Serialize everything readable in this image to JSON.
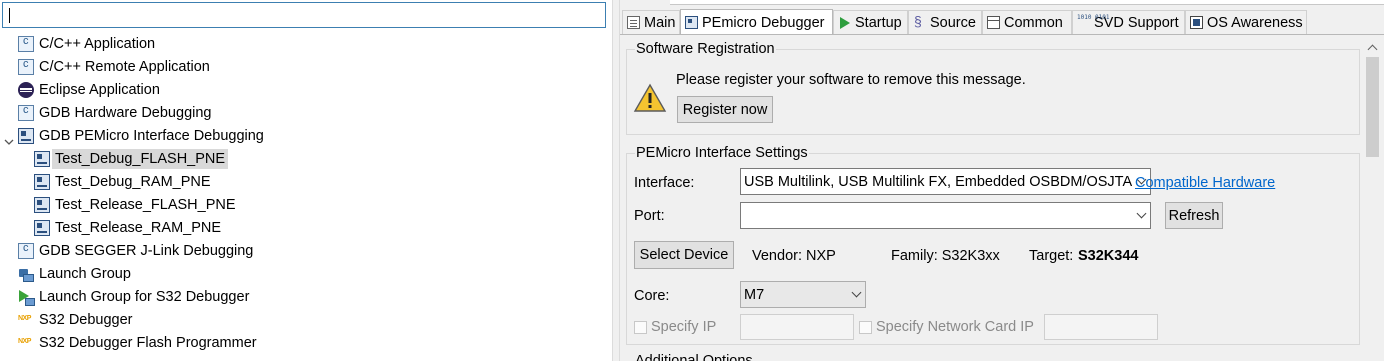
{
  "filter": {
    "value": ""
  },
  "tree": {
    "items": [
      {
        "label": "C/C++ Application",
        "icon": "c-app-icon"
      },
      {
        "label": "C/C++ Remote Application",
        "icon": "c-app-icon"
      },
      {
        "label": "Eclipse Application",
        "icon": "eclipse-icon"
      },
      {
        "label": "GDB Hardware Debugging",
        "icon": "c-app-icon"
      },
      {
        "label": "GDB PEMicro Interface Debugging",
        "icon": "pemicro-icon",
        "expanded": true
      },
      {
        "label": "Test_Debug_FLASH_PNE",
        "icon": "pemicro-icon",
        "selected": true
      },
      {
        "label": "Test_Debug_RAM_PNE",
        "icon": "pemicro-icon"
      },
      {
        "label": "Test_Release_FLASH_PNE",
        "icon": "pemicro-icon"
      },
      {
        "label": "Test_Release_RAM_PNE",
        "icon": "pemicro-icon"
      },
      {
        "label": "GDB SEGGER J-Link Debugging",
        "icon": "c-app-icon"
      },
      {
        "label": "Launch Group",
        "icon": "launch-group-icon"
      },
      {
        "label": "Launch Group for S32 Debugger",
        "icon": "launch-group-s32-icon"
      },
      {
        "label": "S32 Debugger",
        "icon": "nxp-icon"
      },
      {
        "label": "S32 Debugger Flash Programmer",
        "icon": "nxp-icon"
      }
    ]
  },
  "tabs": [
    {
      "label": "Main",
      "icon": "doc-icon"
    },
    {
      "label": "PEmicro Debugger",
      "icon": "pemicro-icon",
      "active": true
    },
    {
      "label": "Startup",
      "icon": "play-icon"
    },
    {
      "label": "Source",
      "icon": "source-icon"
    },
    {
      "label": "Common",
      "icon": "common-icon"
    },
    {
      "label": "SVD Support",
      "icon": "svd-icon"
    },
    {
      "label": "OS Awareness",
      "icon": "os-icon"
    }
  ],
  "registration": {
    "title": "Software Registration",
    "message": "Please register your software to remove this message.",
    "button": "Register now",
    "icon": "warning-icon"
  },
  "settings": {
    "title": "PEMicro Interface Settings",
    "interface_label": "Interface:",
    "interface_value": "USB Multilink, USB Multilink FX, Embedded OSBDM/OSJTAG",
    "compatible_link": "Compatible Hardware",
    "port_label": "Port:",
    "port_value": "",
    "refresh_button": "Refresh",
    "select_device_button": "Select Device",
    "vendor": "Vendor: NXP",
    "family": "Family: S32K3xx",
    "target_label": "Target:",
    "target_value": "S32K344",
    "core_label": "Core:",
    "core_value": "M7",
    "specify_ip": "Specify IP",
    "specify_nic": "Specify Network Card IP"
  },
  "additional": {
    "title": "Additional Options"
  },
  "colors": {
    "link": "#0066cc",
    "selection": "#d9d9d9",
    "focus_border": "#3c7fb1",
    "panel_bg": "#f0f0f0"
  }
}
